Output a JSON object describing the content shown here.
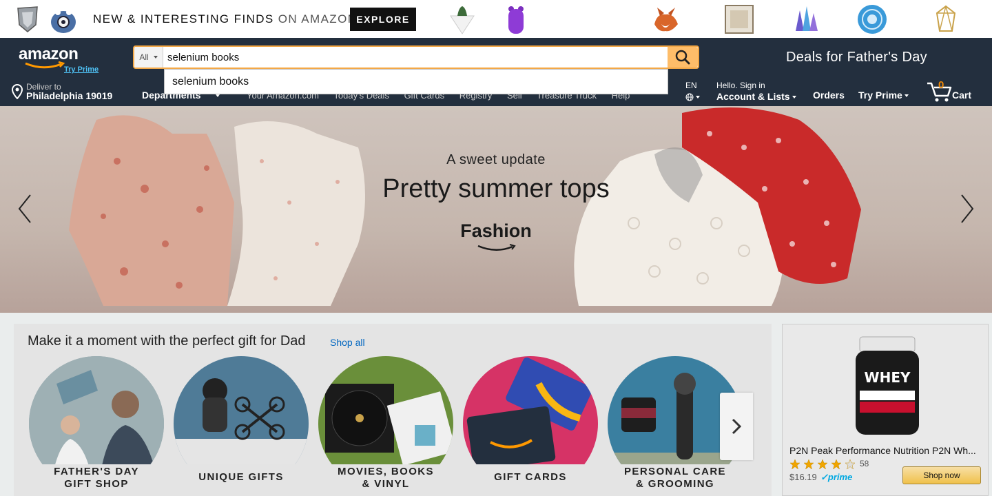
{
  "promo": {
    "headline": "NEW & INTERESTING FINDS",
    "on_amazon": "ON AMAZON",
    "explore_label": "EXPLORE"
  },
  "header": {
    "logo_text": "amazon",
    "try_prime": "Try Prime",
    "search": {
      "department": "All",
      "value": "selenium books",
      "suggestion": "selenium books"
    },
    "deals_banner": "Deals for Father's Day",
    "deliver_to": "Deliver to",
    "deliver_location": "Philadelphia 19019",
    "nav_links": [
      "Departments",
      "Your Amazon.com",
      "Today's Deals",
      "Gift Cards",
      "Registry",
      "Sell",
      "Treasure Truck",
      "Help"
    ],
    "language": "EN",
    "account_greeting": "Hello. Sign in",
    "account_label": "Account & Lists",
    "orders_label": "Orders",
    "try_prime_label": "Try Prime",
    "cart_count": "0",
    "cart_label": "Cart"
  },
  "hero": {
    "kicker": "A sweet update",
    "headline": "Pretty summer tops",
    "brand": "Fashion"
  },
  "gift_section": {
    "title": "Make it a moment with the perfect gift for Dad",
    "shop_all": "Shop all",
    "categories": [
      {
        "line1": "FATHER'S DAY",
        "line2": "GIFT SHOP"
      },
      {
        "line1": "UNIQUE GIFTS",
        "line2": ""
      },
      {
        "line1": "MOVIES, BOOKS",
        "line2": "& VINYL"
      },
      {
        "line1": "GIFT CARDS",
        "line2": ""
      },
      {
        "line1": "PERSONAL CARE",
        "line2": "& GROOMING"
      }
    ]
  },
  "ad": {
    "product_name": "P2N Peak Performance Nutrition P2N Wh...",
    "product_label_text": "WHEY",
    "rating": 3.5,
    "review_count": "58",
    "price": "$16.19",
    "prime": "prime",
    "shop_now": "Shop now"
  },
  "colors": {
    "nav_bg": "#232f3e",
    "search_button": "#febd69",
    "cart_count": "#f08804",
    "link": "#0066c0"
  }
}
